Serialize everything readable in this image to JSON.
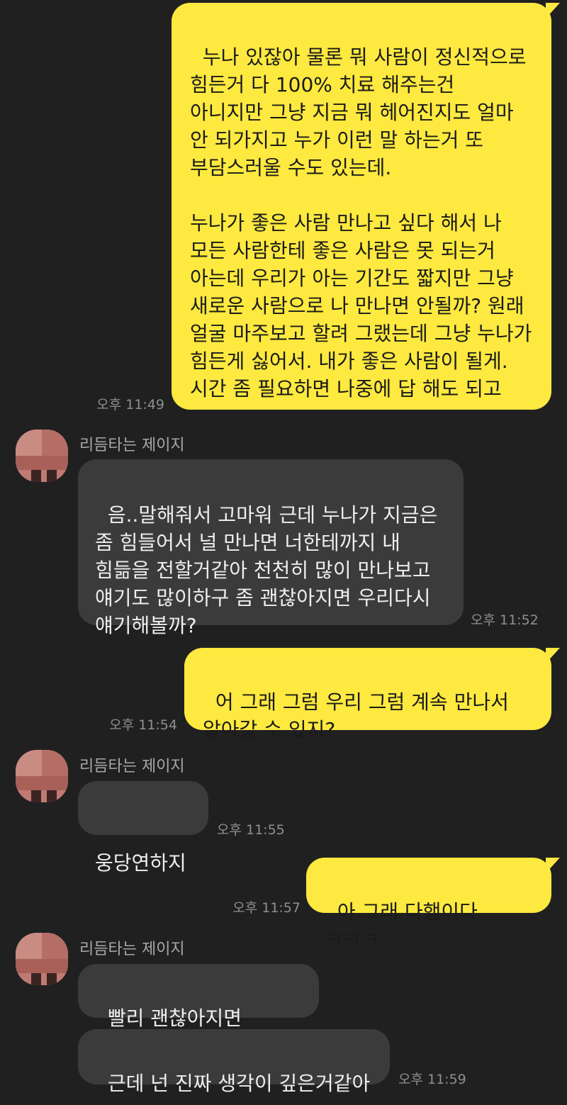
{
  "messages": [
    {
      "sender": "me",
      "text": "누나 있잖아 물론 뭐 사람이 정신적으로 힘든거 다 100% 치료 해주는건 아니지만 그냥 지금 뭐 헤어진지도 얼마 안 되가지고 누가 이런 말 하는거 또 부담스러울 수도 있는데.\n\n누나가 좋은 사람 만나고 싶다 해서 나 모든 사람한테 좋은 사람은 못 되는거 아는데 우리가 아는 기간도 짧지만 그냥 새로운 사람으로 나 만나면 안될까? 원래 얼굴 마주보고 할려 그랬는데 그냥 누나가 힘든게 싫어서. 내가 좋은 사람이 될게. 시간 좀 필요하면 나중에 답 해도 되고",
      "time": "오후 11:49"
    },
    {
      "sender": "other",
      "name": "리듬타는 제이지",
      "text": "음..말해줘서 고마워 근데 누나가 지금은 좀 힘들어서 널 만나면 너한테까지 내 힘듦을 전할거같아 천천히 많이 만나보고 얘기도 많이하구 좀 괜찮아지면 우리다시 얘기해볼까?",
      "time": "오후 11:52"
    },
    {
      "sender": "me",
      "text": "어 그래 그럼 우리 그럼 계속 만나서 알아갈 수 있지?",
      "time": "오후 11:54"
    },
    {
      "sender": "other",
      "name": "리듬타는 제이지",
      "text": "웅당연하지",
      "time": "오후 11:55"
    },
    {
      "sender": "me",
      "text": "아 그래 다행이다 ㅋㅋㅋ",
      "time": "오후 11:57"
    },
    {
      "sender": "other",
      "name": "리듬타는 제이지",
      "text": "빨리 괜찮아지면 좋겠네",
      "time": ""
    },
    {
      "sender": "other",
      "text": "근데 넌 진짜 생각이 깊은거같아",
      "time": "오후 11:59"
    }
  ],
  "colors": {
    "background": "#202021",
    "my_bubble": "#fde93f",
    "their_bubble": "#3b3b3c",
    "timestamp": "#8f8f92"
  }
}
